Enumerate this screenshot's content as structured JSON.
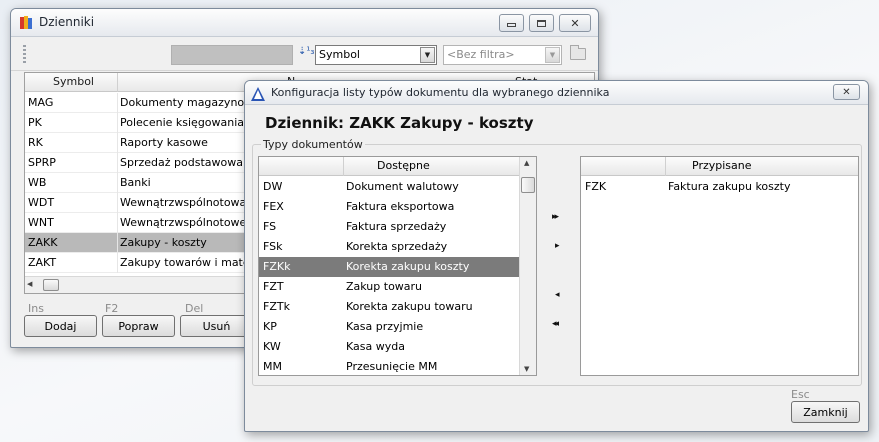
{
  "main_window": {
    "title": "Dzienniki",
    "sort_combo": {
      "value": "Symbol",
      "arrow": "▼"
    },
    "filter_combo": {
      "placeholder": "<Bez filtra>",
      "arrow": "▼"
    },
    "grid": {
      "columns": [
        "Symbol",
        "N",
        "Stat"
      ],
      "rows": [
        {
          "symbol": "MAG",
          "name": "Dokumenty magazynowe"
        },
        {
          "symbol": "PK",
          "name": "Polecenie księgowania"
        },
        {
          "symbol": "RK",
          "name": "Raporty kasowe"
        },
        {
          "symbol": "SPRP",
          "name": "Sprzedaż podstawowa"
        },
        {
          "symbol": "WB",
          "name": "Banki"
        },
        {
          "symbol": "WDT",
          "name": "Wewnątrzwspólnotowa do"
        },
        {
          "symbol": "WNT",
          "name": "Wewnątrzwspólnotowe na"
        },
        {
          "symbol": "ZAKK",
          "name": "Zakupy - koszty",
          "selected": true
        },
        {
          "symbol": "ZAKT",
          "name": "Zakupy towarów i materiał"
        }
      ]
    },
    "hints": {
      "add": "Ins",
      "edit": "F2",
      "delete": "Del"
    },
    "buttons": {
      "add": "Dodaj",
      "edit": "Popraw",
      "delete": "Usuń"
    }
  },
  "dialog": {
    "title": "Konfiguracja listy typów dokumentu dla wybranego dziennika",
    "heading": "Dziennik: ZAKK   Zakupy - koszty",
    "group_label": "Typy dokumentów",
    "available": {
      "header": "Dostępne",
      "rows": [
        {
          "code": "DW",
          "name": "Dokument walutowy"
        },
        {
          "code": "FEX",
          "name": "Faktura eksportowa"
        },
        {
          "code": "FS",
          "name": "Faktura sprzedaży"
        },
        {
          "code": "FSk",
          "name": "Korekta sprzedaży"
        },
        {
          "code": "FZKk",
          "name": "Korekta zakupu koszty",
          "selected": true
        },
        {
          "code": "FZT",
          "name": "Zakup towaru"
        },
        {
          "code": "FZTk",
          "name": "Korekta zakupu towaru"
        },
        {
          "code": "KP",
          "name": "Kasa przyjmie"
        },
        {
          "code": "KW",
          "name": "Kasa wyda"
        },
        {
          "code": "MM",
          "name": "Przesunięcie MM"
        }
      ]
    },
    "assigned": {
      "header": "Przypisane",
      "rows": [
        {
          "code": "FZK",
          "name": "Faktura zakupu koszty"
        }
      ]
    },
    "move_buttons": {
      "all_right": "▸▸",
      "right": "▸",
      "left": "◂",
      "all_left": "◂◂"
    },
    "close_hint": "Esc",
    "close_button": "Zamknij"
  },
  "colors": {
    "selection_main": "#b9b9b9",
    "selection_dialog": "#7b7b7b",
    "accent": "#2a55b5"
  }
}
